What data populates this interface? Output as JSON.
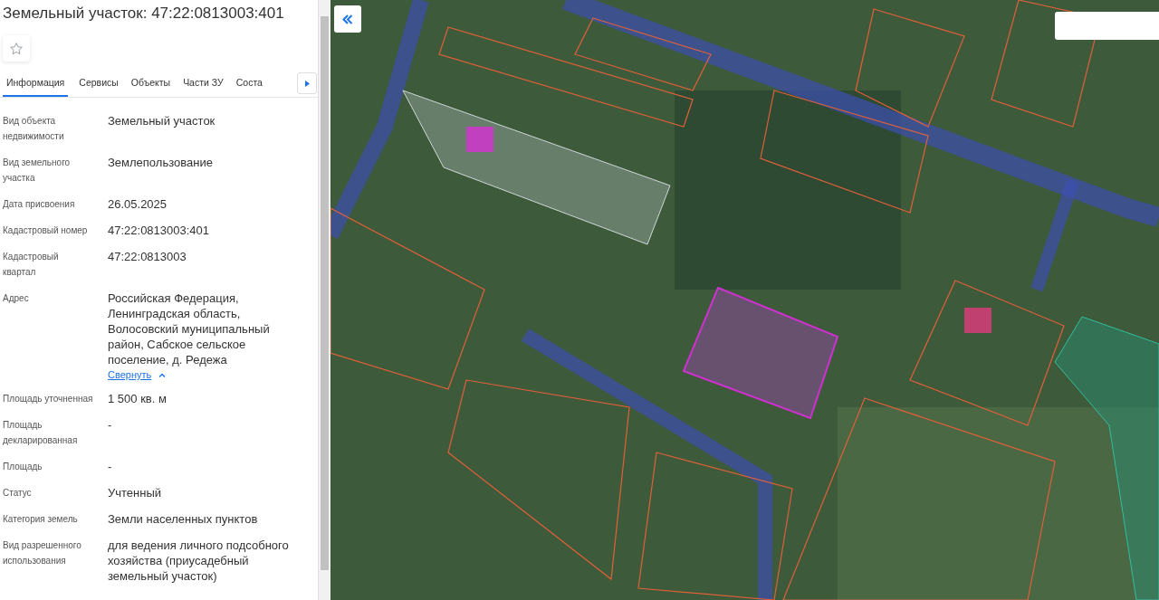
{
  "panel": {
    "title": "Земельный участок: 47:22:0813003:401",
    "favorite": false,
    "tabs": [
      {
        "label": "Информация",
        "selected": true
      },
      {
        "label": "Сервисы",
        "selected": false
      },
      {
        "label": "Объекты",
        "selected": false
      },
      {
        "label": "Части ЗУ",
        "selected": false
      },
      {
        "label": "Соста",
        "selected": false
      }
    ],
    "rows": [
      {
        "label": "Вид объекта недвижимости",
        "value": "Земельный участок"
      },
      {
        "label": "Вид земельного участка",
        "value": "Землепользование"
      },
      {
        "label": "Дата присвоения",
        "value": "26.05.2025"
      },
      {
        "label": "Кадастровый номер",
        "value": "47:22:0813003:401"
      },
      {
        "label": "Кадастровый квартал",
        "value": "47:22:0813003"
      },
      {
        "label": "Адрес",
        "value": "Российская Федерация, Ленинградская область, Волосовский муниципальный район, Сабское сельское поселение, д. Редежа",
        "link": "Свернуть",
        "expanded": true
      },
      {
        "label": "Площадь уточненная",
        "value": "1 500 кв. м"
      },
      {
        "label": "Площадь декларированная",
        "value": "-"
      },
      {
        "label": "Площадь",
        "value": "-"
      },
      {
        "label": "Статус",
        "value": "Учтенный"
      },
      {
        "label": "Категория земель",
        "value": "Земли населенных пунктов"
      },
      {
        "label": "Вид разрешенного использования",
        "value": "для ведения личного подсобного хозяйства (приусадебный земельный участок)"
      }
    ]
  }
}
